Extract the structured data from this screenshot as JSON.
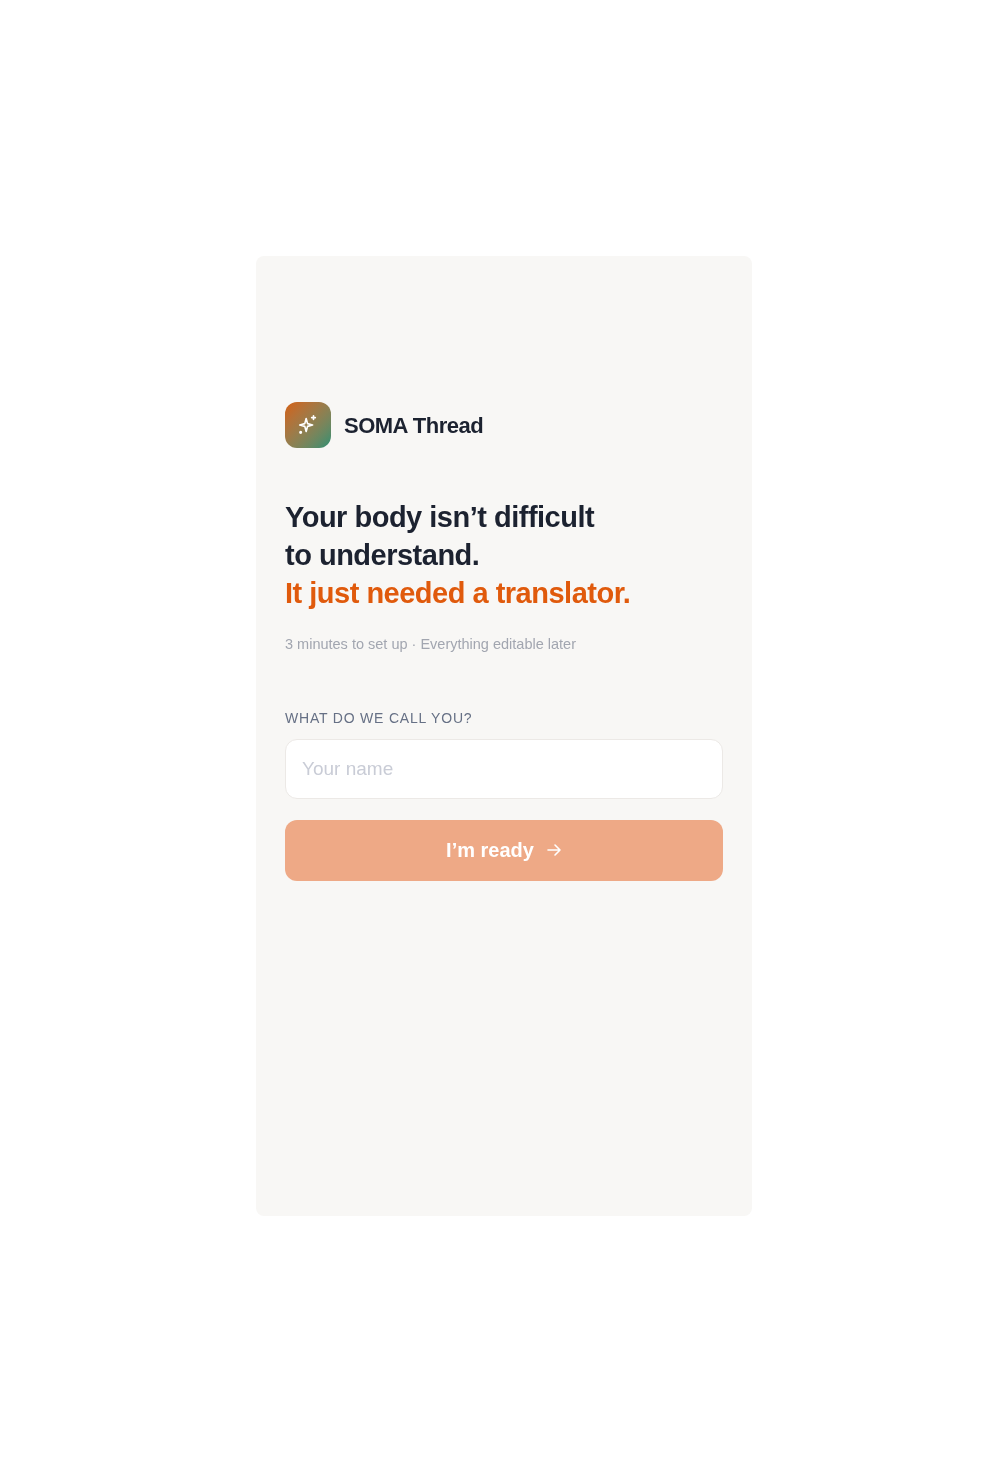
{
  "brand": {
    "name": "SOMA Thread"
  },
  "headline": {
    "lines": [
      "Your body isn’t difficult",
      "to understand."
    ],
    "accent": "It just needed a translator."
  },
  "subtitle": "3 minutes to set up · Everything editable later",
  "name_field": {
    "label": "WHAT DO WE CALL YOU?",
    "placeholder": "Your name"
  },
  "submit_button": {
    "label": "I’m ready",
    "disabled": true
  }
}
